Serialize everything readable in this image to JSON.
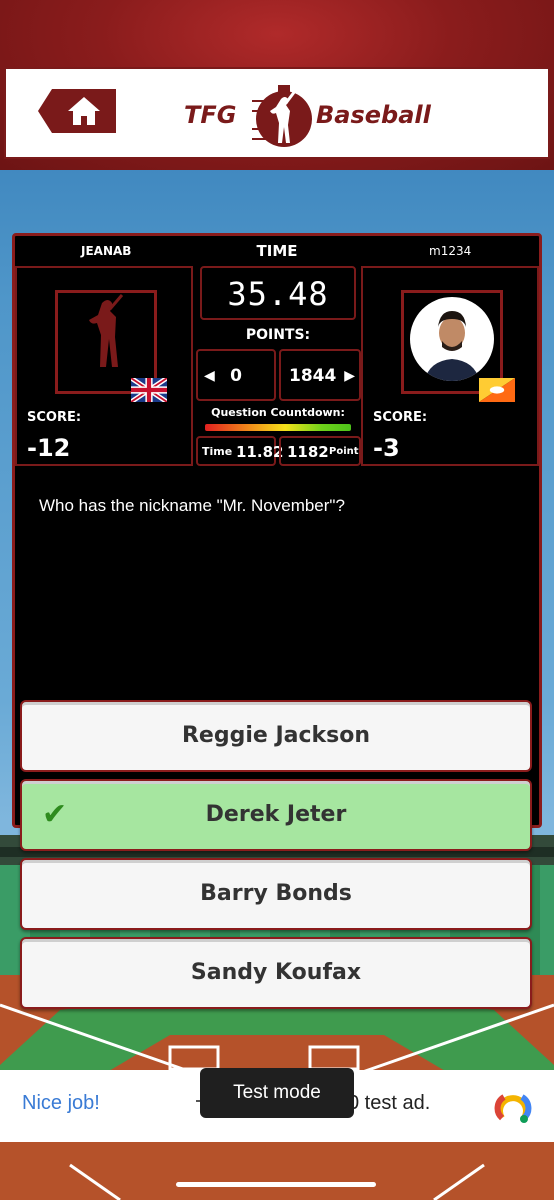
{
  "header": {
    "home_icon": "home-icon",
    "logo_left": "TFG",
    "logo_right": "Baseball"
  },
  "game": {
    "time_label": "TIME",
    "timer": "35.48",
    "points_label": "POINTS:",
    "points_left": "0",
    "points_right": "1844",
    "countdown_label": "Question Countdown:",
    "time_small_label": "Time",
    "time_small_value": "11.82",
    "point_small_value": "1182",
    "point_small_label": "Point"
  },
  "player_left": {
    "name": "JEANAB",
    "score_label": "SCORE:",
    "score": "-12",
    "flag": "uk-flag"
  },
  "player_right": {
    "name": "m1234",
    "score_label": "SCORE:",
    "score": "-3",
    "flag": "bhutan-flag"
  },
  "question": "Who has the nickname \"Mr. November\"?",
  "answers": [
    {
      "label": "Reggie Jackson",
      "state": "normal"
    },
    {
      "label": "Derek Jeter",
      "state": "correct"
    },
    {
      "label": "Barry Bonds",
      "state": "normal"
    },
    {
      "label": "Sandy Koufax",
      "state": "normal"
    }
  ],
  "ad": {
    "left_text": "Nice job!",
    "right_text": "0 test ad.",
    "toast": "Test mode",
    "icon": "ad-choices-icon"
  },
  "colors": {
    "brand": "#7a1a1a",
    "correct": "#a6e6a0"
  }
}
